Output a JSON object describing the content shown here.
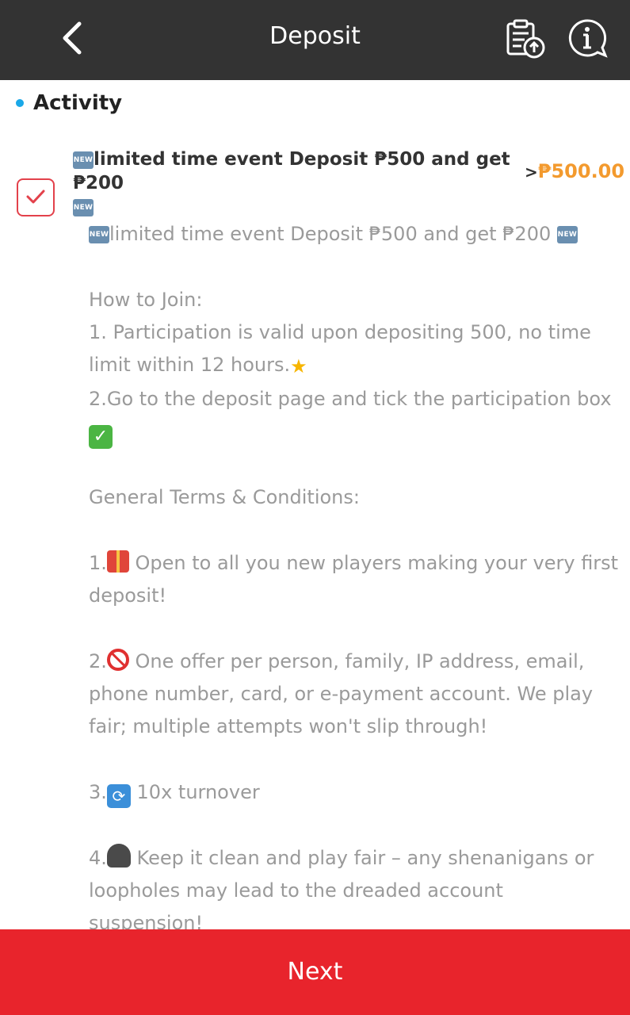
{
  "header": {
    "title": "Deposit",
    "back_icon": "chevron-left-icon",
    "records_icon": "clipboard-upload-icon",
    "help_icon": "info-chat-icon"
  },
  "section": {
    "label": "Activity",
    "dot_color": "#1aa8e8"
  },
  "event": {
    "selected": true,
    "new_tag": "NEW",
    "title": "limited time event Deposit ₱500 and get ₱200",
    "amount_prefix": ">",
    "amount": "₱500.00"
  },
  "description": {
    "headline": "limited time event Deposit ₱500 and get ₱200",
    "how_to_join": "How to Join:",
    "step1": "1. Participation is valid upon depositing 500, no time limit within 12 hours.",
    "step2": "2.Go to the deposit page and tick the participation box",
    "terms_heading": "General Terms & Conditions:",
    "term1_num": "1.",
    "term1": " Open to all you new players making your very first deposit!",
    "term2_num": "2.",
    "term2": " One offer per person, family, IP address, email, phone number, card, or e-payment account. We play fair; multiple attempts won't slip through!",
    "term3_num": "3.",
    "term3": " 10x turnover",
    "term4_num": "4.",
    "term4": " Keep it clean and play fair – any shenanigans or loopholes may lead to the dreaded account suspension!"
  },
  "footer": {
    "next_label": "Next",
    "color": "#e8242c"
  },
  "colors": {
    "header_bg": "#333333",
    "amount": "#f39a2e",
    "checkbox": "#e3414b"
  }
}
